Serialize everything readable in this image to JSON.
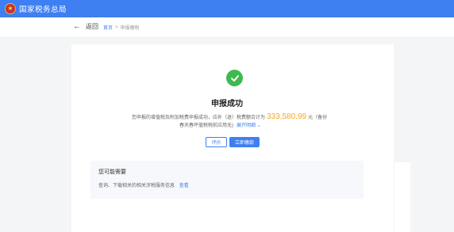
{
  "header": {
    "app_title": "国家税务总局",
    "logo_icon": "national-emblem"
  },
  "nav": {
    "back_label": "返回",
    "breadcrumbs": [
      "首页",
      "申报缴税"
    ]
  },
  "result": {
    "title": "申报成功",
    "desc_prefix": "您申报的增值税及附加税费申报成功，应补（退）税费额合计为",
    "amount": "333,580.99",
    "desc_suffix": "元（备份",
    "desc_line2": "春天春坪值税税前应用无)",
    "expand_label": "展开明细",
    "buttons": {
      "outline": "评价",
      "primary": "立即缴款"
    }
  },
  "needs": {
    "title": "您可能需要",
    "item_text": "查询、下载相关的相关涉税服务信息",
    "item_link": "查看"
  },
  "colors": {
    "brand_blue": "#3e7ff2",
    "success_green": "#3fb950",
    "amount_orange": "#f5a623"
  }
}
